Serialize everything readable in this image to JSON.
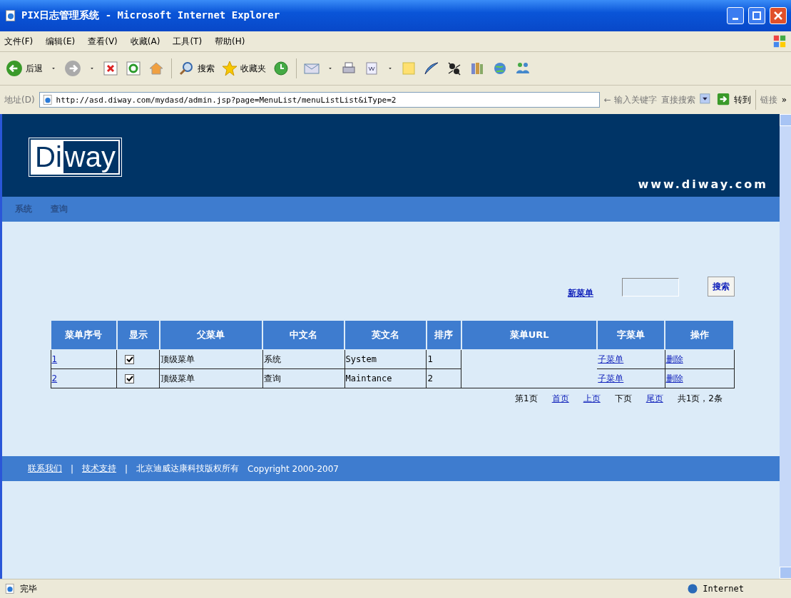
{
  "window": {
    "title": "PIX日志管理系统 - Microsoft Internet Explorer"
  },
  "menu": [
    "文件(F)",
    "编辑(E)",
    "查看(V)",
    "收藏(A)",
    "工具(T)",
    "帮助(H)"
  ],
  "toolbar": [
    {
      "kind": "back",
      "label": "后退"
    },
    {
      "kind": "caret"
    },
    {
      "kind": "forward"
    },
    {
      "kind": "caret"
    },
    {
      "kind": "stop"
    },
    {
      "kind": "refresh"
    },
    {
      "kind": "home"
    },
    {
      "kind": "sep"
    },
    {
      "kind": "search",
      "label": "搜索"
    },
    {
      "kind": "favorites",
      "label": "收藏夹"
    },
    {
      "kind": "history"
    },
    {
      "kind": "sep"
    },
    {
      "kind": "mail"
    },
    {
      "kind": "caret"
    },
    {
      "kind": "print"
    },
    {
      "kind": "edit"
    },
    {
      "kind": "caret"
    },
    {
      "kind": "note"
    },
    {
      "kind": "feather"
    },
    {
      "kind": "bug"
    },
    {
      "kind": "book"
    },
    {
      "kind": "globe"
    },
    {
      "kind": "people"
    }
  ],
  "address": {
    "label": "地址(D)",
    "url": "http://asd.diway.com/mydasd/admin.jsp?page=MenuList/menuListList&iType=2",
    "search_placeholder": "← 输入关键字",
    "search_button": "直接搜索",
    "go": "转到",
    "links": "链接",
    "more": "»"
  },
  "header": {
    "logo": [
      "Di",
      "way"
    ],
    "site": "www.diway.com"
  },
  "nav": [
    "系统",
    "查询"
  ],
  "actions": {
    "new_menu": "新菜单",
    "search_button": "搜索"
  },
  "table": {
    "columns": [
      "菜单序号",
      "显示",
      "父菜单",
      "中文名",
      "英文名",
      "排序",
      "菜单URL",
      "字菜单",
      "操作"
    ],
    "rows": [
      {
        "id": "1",
        "shown": true,
        "parent": "顶级菜单",
        "cn": "系统",
        "en": "System",
        "order": "1",
        "sub": "子菜单",
        "op": "删除"
      },
      {
        "id": "2",
        "shown": true,
        "parent": "顶级菜单",
        "cn": "查询",
        "en": "Maintance",
        "order": "2",
        "sub": "子菜单",
        "op": "删除"
      }
    ]
  },
  "pagination": [
    {
      "text": "第1页",
      "link": false
    },
    {
      "text": "首页",
      "link": true
    },
    {
      "text": "上页",
      "link": true
    },
    {
      "text": "下页",
      "link": false
    },
    {
      "text": "尾页",
      "link": true
    },
    {
      "text": "共1页，2条",
      "link": false
    }
  ],
  "footer": [
    {
      "kind": "link",
      "text": "联系我们"
    },
    {
      "kind": "sep",
      "text": "|"
    },
    {
      "kind": "link",
      "text": "技术支持"
    },
    {
      "kind": "sep",
      "text": "|"
    },
    {
      "kind": "text",
      "text": "北京迪威达康科技版权所有"
    },
    {
      "kind": "text",
      "text": "Copyright 2000-2007"
    }
  ],
  "status": {
    "text": "完毕",
    "zone": "Internet"
  }
}
